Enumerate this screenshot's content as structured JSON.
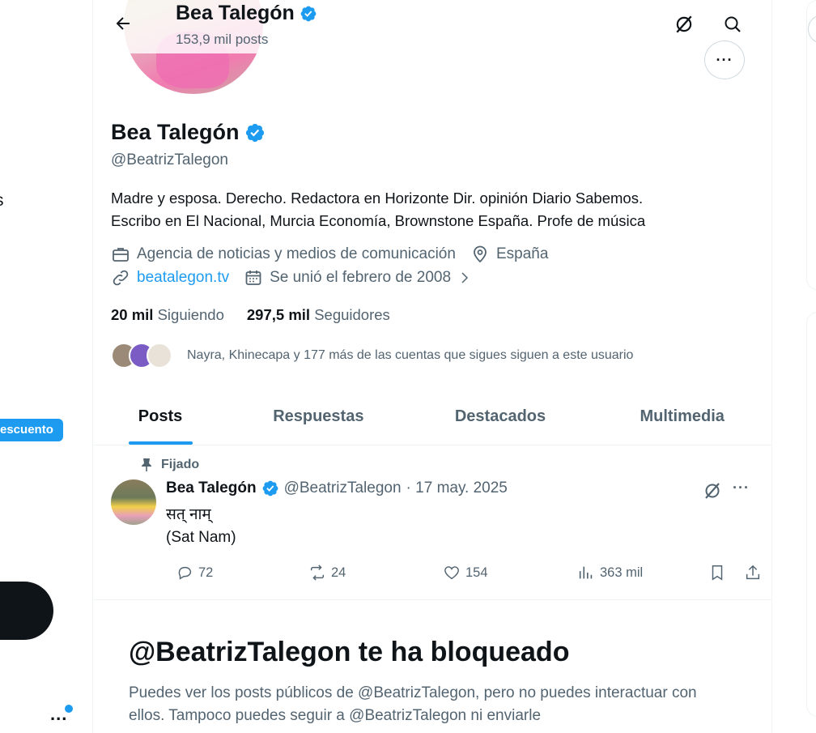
{
  "sidebar": {
    "partial_label": "s",
    "discount_badge": "escuento",
    "more_label": "..."
  },
  "header": {
    "name": "Bea Talegón",
    "post_count": "153,9 mil posts"
  },
  "profile": {
    "name": "Bea Talegón",
    "handle": "@BeatrizTalegon",
    "bio_line1": "Madre y esposa. Derecho. Redactora en Horizonte  Dir. opinión Diario Sabemos.",
    "bio_line2": "Escribo en El Nacional, Murcia Economía, Brownstone España. Profe de música",
    "category": "Agencia de noticias y medios de comunicación",
    "location": "España",
    "website": "beatalegon.tv",
    "joined": "Se unió el febrero de 2008",
    "following_count": "20 mil",
    "following_label": "Siguiendo",
    "followers_count": "297,5 mil",
    "followers_label": "Seguidores",
    "followed_by": "Nayra, Khinecapa y 177 más de las cuentas que sigues siguen a este usuario",
    "more_button": "···"
  },
  "tabs": [
    {
      "label": "Posts",
      "active": true
    },
    {
      "label": "Respuestas",
      "active": false
    },
    {
      "label": "Destacados",
      "active": false
    },
    {
      "label": "Multimedia",
      "active": false
    }
  ],
  "tweet": {
    "pinned_label": "Fijado",
    "author_name": "Bea Talegón",
    "author_handle": "@BeatrizTalegon",
    "date": "· 17 may. 2025",
    "text_line1": "सत् नाम्",
    "text_line2": "(Sat Nam)",
    "more": "···",
    "replies": "72",
    "reposts": "24",
    "likes": "154",
    "views": "363 mil"
  },
  "blocked": {
    "title": "@BeatrizTalegon te ha bloqueado",
    "text": "Puedes ver los posts públicos de @BeatrizTalegon, pero no puedes interactuar con ellos. Tampoco puedes seguir a @BeatrizTalegon ni enviarle"
  },
  "colors": {
    "accent": "#1d9bf0",
    "text": "#0f1419",
    "secondary": "#536471",
    "border": "#eff3f4"
  }
}
